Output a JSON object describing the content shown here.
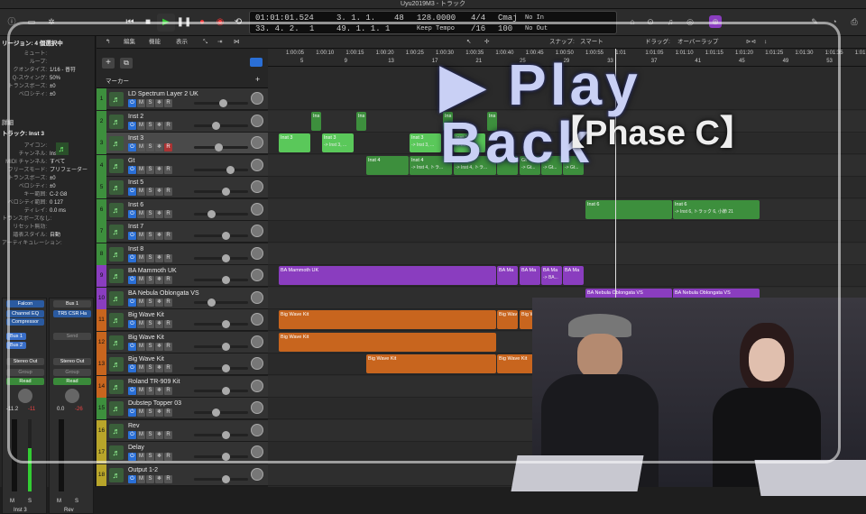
{
  "window": {
    "title": "Uyu2019M3 - トラック"
  },
  "transport": {
    "position": "01:01:01.524",
    "bars": "3. 1. 1.",
    "bars2": "33. 4. 2.",
    "bars3": "1",
    "bars4": "49. 1. 1.",
    "bars5": "1",
    "bpm_top": "48",
    "tempo": "128.0000",
    "tempo_mode": "Keep Tempo",
    "time_sig": "4/4",
    "division": "/16",
    "key": "Cmaj",
    "val100": "100",
    "in": "No In",
    "out": "No Out"
  },
  "inspector": {
    "region_header": "リージョン: 4 個選択中",
    "region_rows": [
      {
        "k": "ミュート:",
        "v": ""
      },
      {
        "k": "ループ:",
        "v": ""
      },
      {
        "k": "クオンタイズ:",
        "v": "1/16 - 普符"
      },
      {
        "k": "Q-スウィング:",
        "v": "50%"
      },
      {
        "k": "トランスポーズ:",
        "v": "±0"
      },
      {
        "k": "ベロシティ:",
        "v": "±0"
      }
    ],
    "details_label": "詳細",
    "track_header": "トラック: Inst 3",
    "track_rows": [
      {
        "k": "アイコン:",
        "v": ""
      },
      {
        "k": "チャンネル:",
        "v": "Inst 3"
      },
      {
        "k": "MIDI チャンネル:",
        "v": "すべて"
      },
      {
        "k": "フリーズモード:",
        "v": "プリフェーダー"
      },
      {
        "k": "トランスポーズ:",
        "v": "±0"
      },
      {
        "k": "ベロシティ:",
        "v": "±0"
      },
      {
        "k": "キー範囲:",
        "v": "C-2  G8"
      },
      {
        "k": "ベロシティ範囲:",
        "v": "0  127"
      },
      {
        "k": "ディレイ:",
        "v": "0.0 ms"
      },
      {
        "k": "トランスポーズなし:",
        "v": ""
      },
      {
        "k": "リセット無効:",
        "v": ""
      },
      {
        "k": "譜表スタイル:",
        "v": "自動"
      },
      {
        "k": "アーティキュレーション:",
        "v": ""
      }
    ],
    "strip1": {
      "insert": "Falcon",
      "eq": "Channel EQ",
      "comp": "Compressor",
      "bus1": "Bus 1",
      "bus2": "Bus 2",
      "out": "Stereo Out",
      "group": "Group",
      "mode": "Read",
      "vol": "-11.2",
      "peak": "-11",
      "name": "Inst 3"
    },
    "strip2": {
      "top": "Bus 1",
      "insert": "TR5 CSR Ha",
      "send": "Send",
      "out": "Stereo Out",
      "group": "Group",
      "mode": "Read",
      "vol": "0.0",
      "peak": "-26",
      "name": "Rev"
    },
    "ms": [
      "M",
      "S",
      "M",
      "S"
    ]
  },
  "menubar": {
    "edit": "編集",
    "func": "機能",
    "view": "表示",
    "snap": "スナップ:",
    "snap_val": "スマート",
    "drag": "ドラッグ:",
    "drag_val": "オーバーラップ",
    "marker": "マーカー"
  },
  "ruler": {
    "times": [
      "1:00:05",
      "1:00:10",
      "1:00:15",
      "1:00:20",
      "1:00:25",
      "1:00:30",
      "1:00:35",
      "1:00:40",
      "1:00:45",
      "1:00:50",
      "1:00:55",
      "1:01",
      "1:01:05",
      "1:01:10",
      "1:01:15",
      "1:01:20",
      "1:01:25",
      "1:01:30",
      "1:01:35",
      "1:01:40"
    ],
    "bars": [
      "5",
      "9",
      "13",
      "17",
      "21",
      "25",
      "29",
      "33",
      "37",
      "41",
      "45",
      "49",
      "53"
    ]
  },
  "tracks": [
    {
      "num": "1",
      "name": "LD Spectrum Layer 2 UK",
      "color": "#3d8f3d"
    },
    {
      "num": "2",
      "name": "Inst 2",
      "color": "#3d8f3d"
    },
    {
      "num": "3",
      "name": "Inst 3",
      "color": "#3d8f3d"
    },
    {
      "num": "4",
      "name": "Gt",
      "color": "#3d8f3d"
    },
    {
      "num": "5",
      "name": "Inst 5",
      "color": "#3d8f3d"
    },
    {
      "num": "6",
      "name": "Inst 6",
      "color": "#3d8f3d"
    },
    {
      "num": "7",
      "name": "Inst 7",
      "color": "#3d8f3d"
    },
    {
      "num": "8",
      "name": "Inst 8",
      "color": "#3d8f3d"
    },
    {
      "num": "9",
      "name": "BA Mammoth UK",
      "color": "#8a3dbf"
    },
    {
      "num": "10",
      "name": "BA Nebula Oblongata VS",
      "color": "#8a3dbf"
    },
    {
      "num": "11",
      "name": "Big Wave Kit",
      "color": "#c8651e"
    },
    {
      "num": "12",
      "name": "Big Wave Kit",
      "color": "#c8651e"
    },
    {
      "num": "13",
      "name": "Big Wave Kit",
      "color": "#c8651e"
    },
    {
      "num": "14",
      "name": "Roland TR-909 Kit",
      "color": "#c8651e"
    },
    {
      "num": "15",
      "name": "Dubstep Topper 03",
      "color": "#3d8f3d"
    },
    {
      "num": "16",
      "name": "Rev",
      "color": "#b8a52a"
    },
    {
      "num": "17",
      "name": "Delay",
      "color": "#b8a52a"
    },
    {
      "num": "18",
      "name": "Output 1-2",
      "color": "#b8a52a"
    }
  ],
  "regions": {
    "ins": "Ins",
    "inst3": "Inst 3",
    "inst3_sub": "-> Inst 3, ...",
    "inst4": "Inst 4",
    "inst4_sub": "-> Inst 4, トラ...",
    "gt": "Gt",
    "gt_sub": "-> Gt...",
    "inst6": "Inst 6",
    "inst6_sub": "-> Inst 6, トラック 6, 小節 21",
    "mammoth": "BA Mammoth UK",
    "ba_ma": "BA Ma",
    "ba_sub": "-> BA...",
    "nebula": "BA Nebula Oblongata VS",
    "nebula_sub": "-> BA Nebula Oblongata VS...",
    "bigwave": "Big Wave Kit",
    "big_wav": "Big Wav",
    "big_sub": "-> Big...",
    "roi": "Roi"
  },
  "overlay": {
    "title": "▶ Play Back",
    "subtitle": "【Phase C】"
  },
  "colors": {
    "green": "#3d8f3d",
    "purple": "#8a3dbf",
    "orange": "#c8651e",
    "yellow": "#b8a52a",
    "accent": "#2a6fd6"
  }
}
